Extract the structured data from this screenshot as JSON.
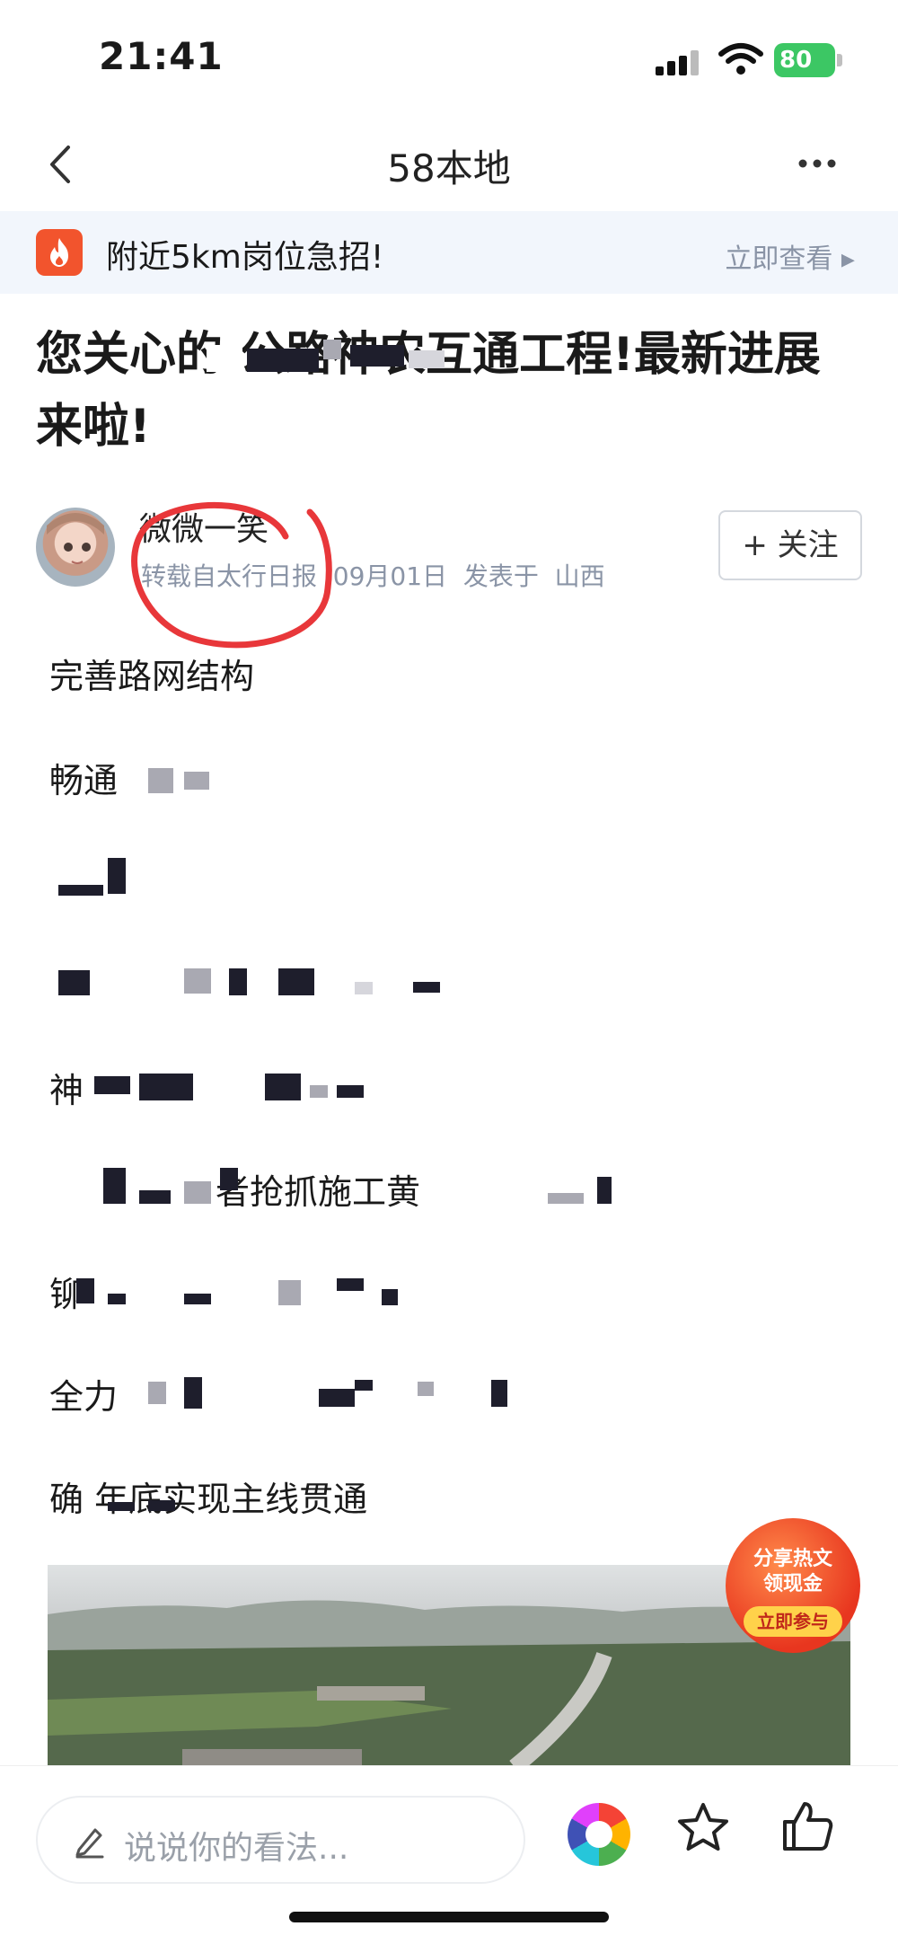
{
  "status_bar": {
    "time": "21:41",
    "battery": "80"
  },
  "nav": {
    "title": "58本地"
  },
  "banner": {
    "text": "附近5km岗位急招!",
    "link": "立即查看"
  },
  "article": {
    "title": "您关心的  公路神农互通工程!最新进展来啦!",
    "author": "微微一笑",
    "meta": "转载自太行日报  09月01日  发表于  山西",
    "follow": "+ 关注"
  },
  "paragraphs": [
    "完善路网结构",
    "畅通",
    "",
    "",
    "神",
    "者抢抓施工黄",
    "铆",
    "全力",
    "确  年底实现主线贯通"
  ],
  "promo": {
    "line1": "分享热文",
    "line2": "领现金",
    "button": "立即参与"
  },
  "comment": {
    "placeholder": "说说你的看法..."
  },
  "colors": {
    "brand_orange": "#f2542d",
    "follow_border": "#d4d8de",
    "banner_bg": "#f2f6fc",
    "battery_green": "#3cc764"
  }
}
